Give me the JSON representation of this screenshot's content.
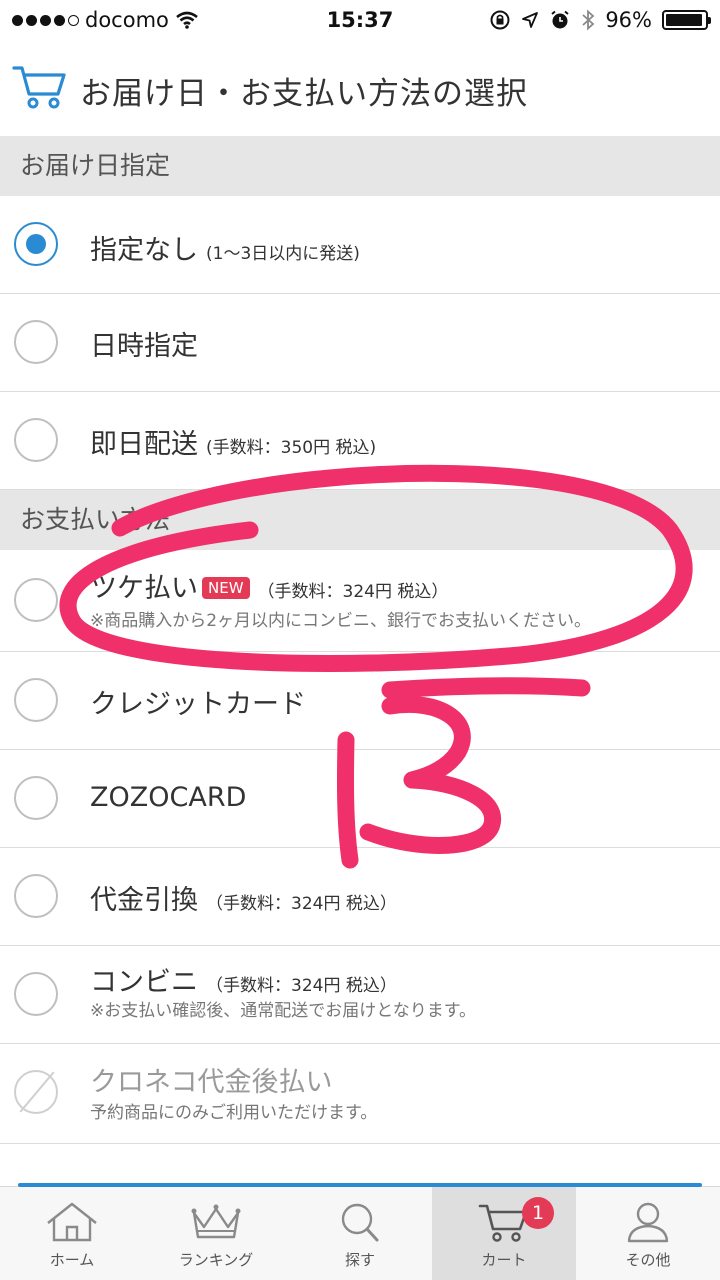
{
  "status_bar": {
    "carrier": "docomo",
    "time": "15:37",
    "battery": "96%",
    "battery_level": 0.96,
    "signal_bars": 4
  },
  "header": {
    "title": "お届け日・お支払い方法の選択"
  },
  "delivery": {
    "section_title": "お届け日指定",
    "options": [
      {
        "label": "指定なし",
        "fee": "(1〜3日以内に発送)",
        "selected": true
      },
      {
        "label": "日時指定",
        "fee": "",
        "selected": false
      },
      {
        "label": "即日配送",
        "fee": "(手数料：350円 税込)",
        "selected": false
      }
    ]
  },
  "payment": {
    "section_title": "お支払い方法",
    "options": [
      {
        "label": "ツケ払い",
        "badge": "NEW",
        "fee": "（手数料：324円 税込）",
        "note": "※商品購入から2ヶ月以内にコンビニ、銀行でお支払いください。"
      },
      {
        "label": "クレジットカード",
        "fee": "",
        "note": ""
      },
      {
        "label": "ZOZOCARD",
        "fee": "",
        "note": ""
      },
      {
        "label": "代金引換",
        "fee": "（手数料：324円 税込）",
        "note": ""
      },
      {
        "label": "コンビニ",
        "fee": "（手数料：324円 税込）",
        "note": "※お支払い確認後、通常配送でお届けとなります。"
      },
      {
        "label": "クロネコ代金後払い",
        "fee": "",
        "note": "予約商品にのみご利用いただけます。",
        "disabled": true
      }
    ]
  },
  "annotation": {
    "text": "13",
    "color": "#f0306a"
  },
  "tabbar": {
    "tabs": [
      {
        "label": "ホーム",
        "icon": "home-icon"
      },
      {
        "label": "ランキング",
        "icon": "crown-icon"
      },
      {
        "label": "探す",
        "icon": "search-icon"
      },
      {
        "label": "カート",
        "icon": "cart-icon",
        "active": true,
        "badge": "1"
      },
      {
        "label": "その他",
        "icon": "person-icon"
      }
    ]
  },
  "colors": {
    "accent": "#2a8bd2",
    "badge": "#e33a55",
    "section_bg": "#e6e6e6"
  }
}
